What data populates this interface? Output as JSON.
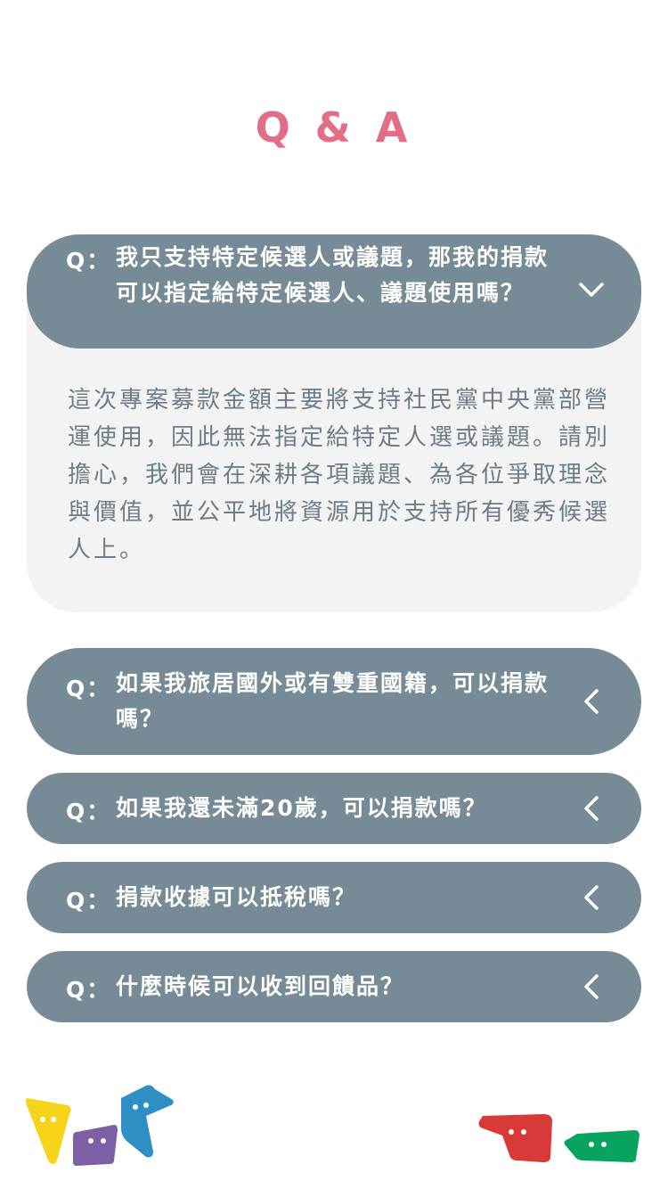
{
  "theme": {
    "accent": "#e36d86",
    "bar": "#768b95",
    "panel_bg": "#f3f3f3",
    "answer_text": "#6d7c86"
  },
  "page": {
    "title": "Q & A"
  },
  "faq": [
    {
      "prefix": "Q：",
      "question": "我只支持特定候選人或議題，那我的捐款可以指定給特定候選人、議題使用嗎？",
      "expanded": true,
      "chevron": "chevron-down-icon",
      "answer": "這次專案募款金額主要將支持社民黨中央黨部營運使用，因此無法指定給特定人選或議題。請別擔心，我們會在深耕各項議題、為各位爭取理念與價值，並公平地將資源用於支持所有優秀候選人上。"
    },
    {
      "prefix": "Q：",
      "question": "如果我旅居國外或有雙重國籍，可以捐款嗎？",
      "expanded": false,
      "chevron": "chevron-left-icon"
    },
    {
      "prefix": "Q：",
      "question": "如果我還未滿20歲，可以捐款嗎？",
      "expanded": false,
      "chevron": "chevron-left-icon"
    },
    {
      "prefix": "Q：",
      "question": "捐款收據可以抵稅嗎？",
      "expanded": false,
      "chevron": "chevron-left-icon"
    },
    {
      "prefix": "Q：",
      "question": "什麼時候可以收到回饋品？",
      "expanded": false,
      "chevron": "chevron-left-icon"
    }
  ],
  "decor": {
    "left_mascots": [
      "yellow-mascot-icon",
      "purple-mascot-icon",
      "blue-mascot-icon"
    ],
    "right_mascots": [
      "red-mascot-icon",
      "green-mascot-icon"
    ],
    "colors": {
      "yellow": "#f7d31a",
      "purple": "#7c5fa5",
      "blue": "#2f8fc4",
      "red": "#d83a37",
      "green": "#06a45e"
    }
  }
}
